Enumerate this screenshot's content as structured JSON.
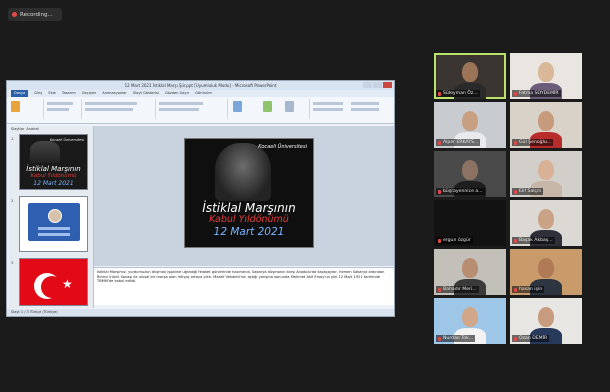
{
  "recording": {
    "label": "Recording..."
  },
  "ppt": {
    "title": "12 Mart 2021 İstiklal Marşı Şiir.ppt [Uyumluluk Modu] - Microsoft PowerPoint",
    "menu": [
      "Dosya",
      "Giriş",
      "Ekle",
      "Tasarım",
      "Geçişler",
      "Animasyonlar",
      "Slayt Gösterisi",
      "Gözden Geçir",
      "Görünüm"
    ],
    "thumb_tabs": [
      "Slaytlar",
      "Anahat"
    ],
    "slide_numbers": [
      "1",
      "2",
      "3"
    ],
    "slide": {
      "university": "Kocaeli Üniversitesi",
      "line1": "İstiklal Marşının",
      "line2": "Kabul Yıldönümü",
      "line3": "12 Mart 2021"
    },
    "notes": "İstiklal Marşımız, yurdumuzun düşman işgaline uğradığı felaket günlerinde hazırlandı. Sakarya düşmanın karşı Anadolu'da kazaçaydır, hemen Sakarya ardından Birinci İnönü Savaşı ile ulusal bir marşa olan ihtiyaç ortaya çıktı. Maarif Vekaleti'nin açtığı yarışma sonunda Mehmet Akif Ersoy'un şiiri 12 Mart 1921 tarihinde TBMM'de kabul edildi.",
    "status": "Slayt 1 / 3   Türkçe (Türkiye)"
  },
  "participants": [
    {
      "name": "Süleyman Öz...",
      "active": true,
      "bg": "#3a3530",
      "skin": "#9c7458",
      "shirt": "#2a2a2a"
    },
    {
      "name": "Fatma SOYDEMİR",
      "active": false,
      "bg": "#e9e6e2",
      "skin": "#d9b89a",
      "shirt": "#6b5d7a"
    },
    {
      "name": "Alper ERKAYS...",
      "active": false,
      "bg": "#c8ccd0",
      "skin": "#c99f82",
      "shirt": "#e9eaee"
    },
    {
      "name": "Gül Şenoğlu...",
      "active": false,
      "bg": "#d9d2c8",
      "skin": "#c79a7c",
      "shirt": "#b92c2c"
    },
    {
      "name": "büşrayennice a...",
      "active": false,
      "bg": "#4a4a4a",
      "skin": "#8c7262",
      "shirt": "#1e1e1e"
    },
    {
      "name": "Elif Salçılı",
      "active": false,
      "bg": "#d2cfcb",
      "skin": "#d8b196",
      "shirt": "#c5b6a8"
    },
    {
      "name": "ergun özgür",
      "active": false,
      "bg": "#121212",
      "skin": "#121212",
      "shirt": "#121212"
    },
    {
      "name": "Başak Akbaş...",
      "active": false,
      "bg": "#dcd8d4",
      "skin": "#caa286",
      "shirt": "#2f2f3a"
    },
    {
      "name": "Bahadır Meri...",
      "active": false,
      "bg": "#c3bfb9",
      "skin": "#b88e72",
      "shirt": "#3a3a3a"
    },
    {
      "name": "hasan işin",
      "active": false,
      "bg": "#c99a6a",
      "skin": "#b07a56",
      "shirt": "#2c3540"
    },
    {
      "name": "Nurdan Tok...",
      "active": false,
      "bg": "#9ec6e6",
      "skin": "#d1a78a",
      "shirt": "#f2f2f2"
    },
    {
      "name": "Ozan DEMİR",
      "active": false,
      "bg": "#e8e6e3",
      "skin": "#c79b7e",
      "shirt": "#283a5c"
    }
  ]
}
